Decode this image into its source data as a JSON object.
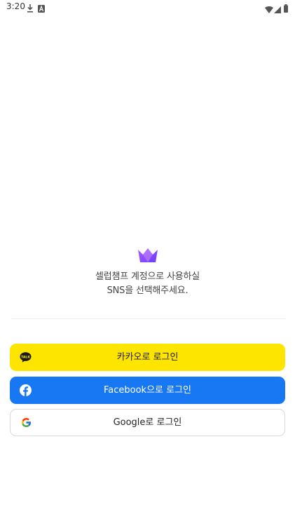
{
  "status_bar": {
    "time": "3:20",
    "icons": [
      "download-icon",
      "a-badge-icon",
      "wifi-icon",
      "signal-icon",
      "battery-icon"
    ]
  },
  "brand": {
    "logo_icon": "crown-icon",
    "headline_line1": "셀럽챔프 계정으로 사용하실",
    "headline_line2": "SNS을 선택해주세요."
  },
  "login_buttons": {
    "kakao": {
      "label": "카카오로 로그인",
      "icon": "kakao-talk-icon",
      "bg_color": "#FEE500"
    },
    "facebook": {
      "label": "Facebook으로 로그인",
      "icon": "facebook-icon",
      "bg_color": "#1877F2"
    },
    "google": {
      "label": "Google로 로그인",
      "icon": "google-icon",
      "bg_color": "#FFFFFF"
    }
  },
  "colors": {
    "accent_purple": "#7B4DFF",
    "accent_violet": "#B05CFF"
  }
}
